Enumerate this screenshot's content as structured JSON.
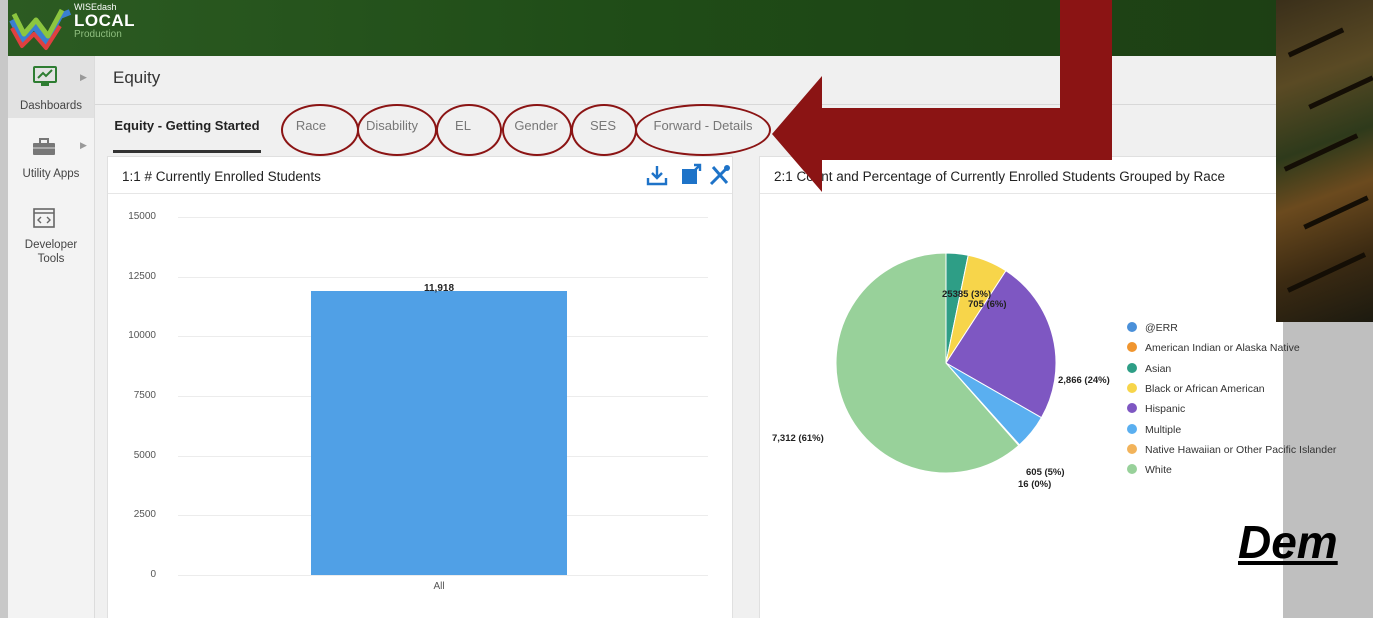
{
  "logo": {
    "small": "WISEdash",
    "big": "LOCAL",
    "env": "Production"
  },
  "sidebar": {
    "items": [
      {
        "label": "Dashboards",
        "icon": "chart-monitor-icon"
      },
      {
        "label": "Utility Apps",
        "icon": "toolbox-icon"
      },
      {
        "label": "Developer Tools",
        "icon": "code-icon"
      }
    ]
  },
  "page": {
    "title": "Equity"
  },
  "tabs": [
    {
      "label": "Equity - Getting Started"
    },
    {
      "label": "Race"
    },
    {
      "label": "Disability"
    },
    {
      "label": "EL"
    },
    {
      "label": "Gender"
    },
    {
      "label": "SES"
    },
    {
      "label": "Forward - Details"
    }
  ],
  "panel1": {
    "title": "1:1 # Currently Enrolled Students",
    "tools": [
      "download-icon",
      "external-link-icon",
      "wrench-tools-icon"
    ]
  },
  "panel2": {
    "title": "2:1 Count and Percentage of Currently Enrolled Students Grouped by Race",
    "pie_labels": [
      "25385 (3%)",
      "705 (6%)",
      "2,866 (24%)",
      "605 (5%)",
      "16 (0%)",
      "7,312 (61%)"
    ]
  },
  "chart_data": [
    {
      "type": "bar",
      "title": "1:1 # Currently Enrolled Students",
      "categories": [
        "All"
      ],
      "values": [
        11918
      ],
      "value_labels": [
        "11,918"
      ],
      "ylim": [
        0,
        15000
      ],
      "yticks": [
        "15000",
        "12500",
        "10000",
        "7500",
        "5000",
        "2500",
        "0"
      ],
      "grid": true,
      "color": "#50a0e6"
    },
    {
      "type": "pie",
      "title": "2:1 Count and Percentage of Currently Enrolled Students Grouped by Race",
      "legend_position": "right",
      "legend": [
        {
          "name": "@ERR",
          "color": "#4a90d9"
        },
        {
          "name": "American Indian or Alaska Native",
          "color": "#f0952f"
        },
        {
          "name": "Asian",
          "color": "#2e9e86"
        },
        {
          "name": "Black or African American",
          "color": "#f7d54a"
        },
        {
          "name": "Hispanic",
          "color": "#7e57c2"
        },
        {
          "name": "Multiple",
          "color": "#5aaff0"
        },
        {
          "name": "Native Hawaiian or Other Pacific Islander",
          "color": "#f2b35a"
        },
        {
          "name": "White",
          "color": "#98d19a"
        }
      ],
      "slices": [
        {
          "name": "@ERR",
          "value": 0,
          "percent": 0,
          "color": "#4a90d9"
        },
        {
          "name": "American Indian or Alaska Native",
          "value": 0,
          "percent": 0,
          "color": "#f0952f"
        },
        {
          "name": "Asian",
          "value": 385,
          "percent": 3,
          "color": "#2e9e86"
        },
        {
          "name": "Black or African American",
          "value": 705,
          "percent": 6,
          "color": "#f7d54a"
        },
        {
          "name": "Hispanic",
          "value": 2866,
          "percent": 24,
          "color": "#7e57c2"
        },
        {
          "name": "Multiple",
          "value": 605,
          "percent": 5,
          "color": "#5aaff0"
        },
        {
          "name": "Native Hawaiian or Other Pacific Islander",
          "value": 16,
          "percent": 0,
          "color": "#f2b35a"
        },
        {
          "name": "White",
          "value": 7312,
          "percent": 61,
          "color": "#98d19a"
        }
      ]
    }
  ],
  "demo_text": "Dem",
  "colors": {
    "topbar": "#1f4c17",
    "arrow": "#8b1414",
    "accent": "#50a0e6"
  }
}
